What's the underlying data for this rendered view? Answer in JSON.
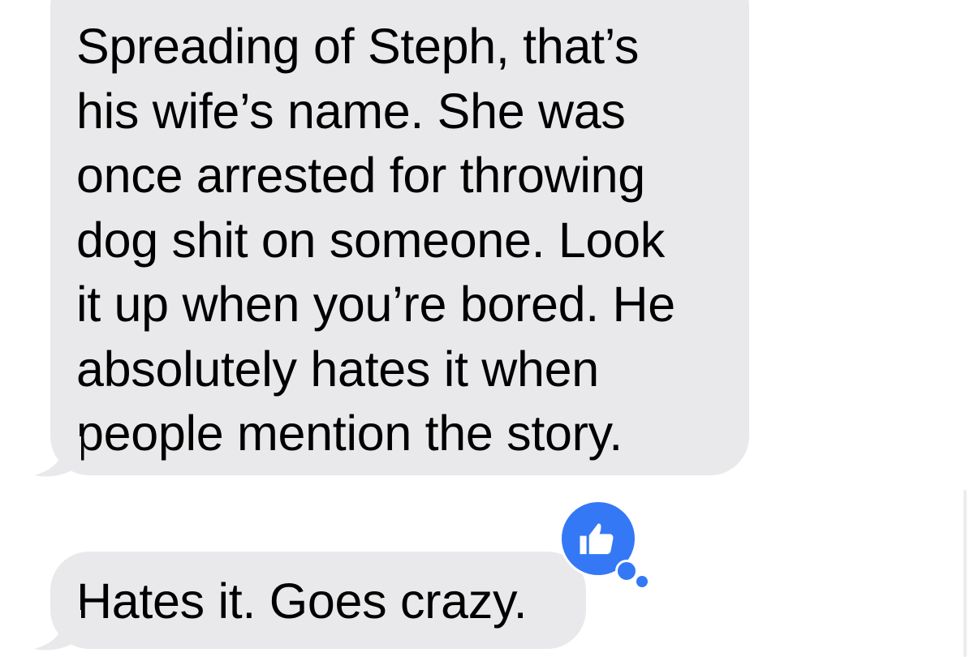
{
  "conversation": {
    "messages": [
      {
        "text": "Spreading of Steph, that’s\nhis wife’s name. She was\nonce arrested for throwing\ndog shit on someone. Look\nit up when you’re bored. He\nabsolutely hates it when\npeople mention the story.",
        "direction": "received"
      },
      {
        "text": "Hates it. Goes crazy.",
        "direction": "received",
        "tapback": "thumbs-up-icon"
      }
    ]
  },
  "colors": {
    "received_bubble": "#e9e9eb",
    "tapback": "#3478f6",
    "background": "#ffffff"
  }
}
